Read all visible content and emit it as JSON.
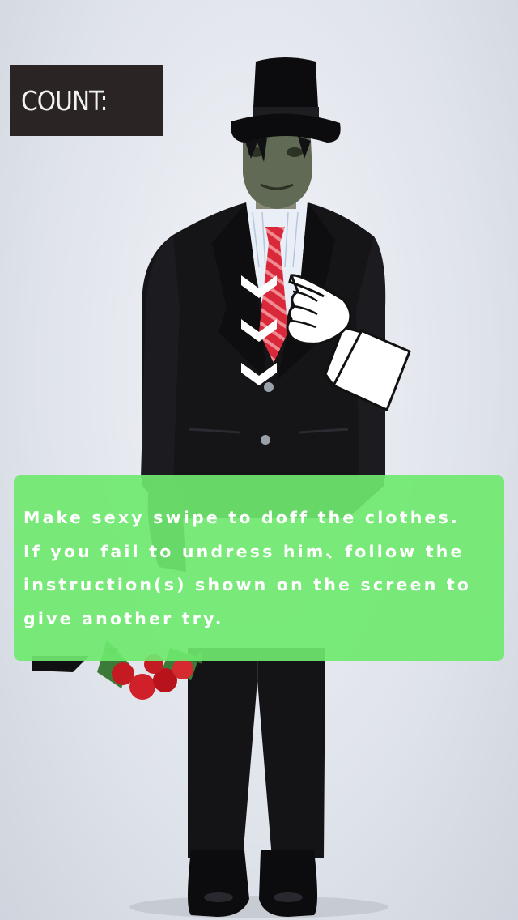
{
  "hud": {
    "count_label": "COUNT:"
  },
  "instructions": {
    "lines": [
      "Make sexy swipe to doff the clothes.",
      "If you fail to undress him、follow the",
      "instruction(s) shown on the screen to",
      "give another try."
    ]
  },
  "hint": {
    "gesture": "swipe-down",
    "icons": [
      "chevron-down-icon",
      "pointing-hand-icon"
    ]
  },
  "colors": {
    "background": "#dfe3ea",
    "count_box": "#2a2524",
    "instruction_panel": "#6fe96f",
    "suit": "#141416",
    "tie": "#d8283a"
  }
}
